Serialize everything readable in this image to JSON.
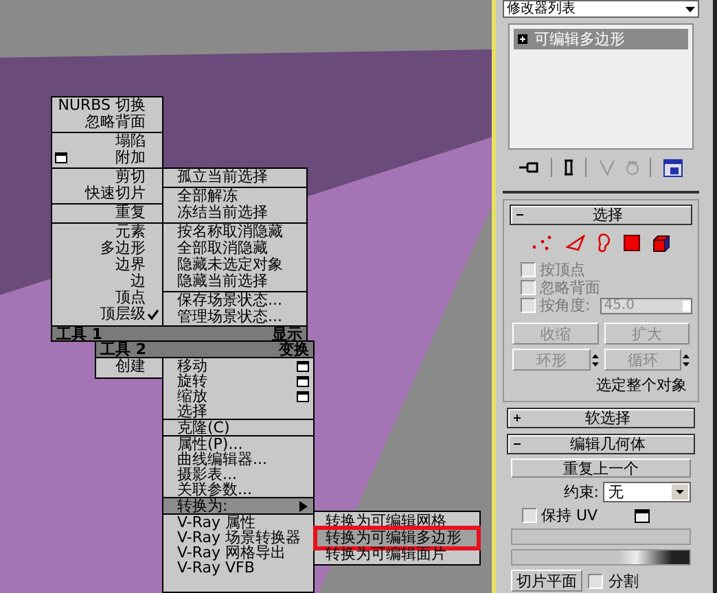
{
  "quad_menu": {
    "tools1": {
      "title": "工具 1",
      "groups": [
        [
          {
            "label": "NURBS 切换",
            "checked": false,
            "options": false
          },
          {
            "label": "忽略背面",
            "checked": false,
            "options": false
          }
        ],
        [
          {
            "label": "塌陷",
            "checked": false,
            "options": false
          },
          {
            "label": "附加",
            "checked": false,
            "options": true
          }
        ],
        [
          {
            "label": "剪切",
            "checked": false,
            "options": false
          },
          {
            "label": "快速切片",
            "checked": false,
            "options": false
          }
        ],
        [
          {
            "label": "重复",
            "checked": false,
            "options": false
          }
        ],
        [
          {
            "label": "元素",
            "checked": false,
            "options": false
          },
          {
            "label": "多边形",
            "checked": false,
            "options": false
          },
          {
            "label": "边界",
            "checked": false,
            "options": false
          },
          {
            "label": "边",
            "checked": false,
            "options": false
          },
          {
            "label": "顶点",
            "checked": false,
            "options": false
          },
          {
            "label": "顶层级",
            "checked": true,
            "options": false
          }
        ]
      ]
    },
    "display": {
      "title": "显示",
      "groups": [
        [
          {
            "label": "孤立当前选择",
            "checked": false,
            "options": false
          }
        ],
        [
          {
            "label": "全部解冻",
            "checked": false,
            "options": false
          },
          {
            "label": "冻结当前选择",
            "checked": false,
            "options": false
          }
        ],
        [
          {
            "label": "按名称取消隐藏",
            "checked": false,
            "options": false
          },
          {
            "label": "全部取消隐藏",
            "checked": false,
            "options": false
          },
          {
            "label": "隐藏未选定对象",
            "checked": false,
            "options": false
          },
          {
            "label": "隐藏当前选择",
            "checked": false,
            "options": false
          }
        ],
        [
          {
            "label": "保存场景状态...",
            "checked": false,
            "options": false
          },
          {
            "label": "管理场景状态...",
            "checked": false,
            "options": false
          }
        ]
      ]
    },
    "tools2": {
      "title": "工具 2",
      "groups": [
        [
          {
            "label": "创建",
            "checked": false,
            "options": false
          }
        ]
      ]
    },
    "transform": {
      "title": "变换",
      "groups": [
        [
          {
            "label": "移动",
            "checked": false,
            "options": true,
            "submenu": false,
            "selected": false
          },
          {
            "label": "旋转",
            "checked": false,
            "options": true,
            "submenu": false,
            "selected": false
          },
          {
            "label": "缩放",
            "checked": false,
            "options": true,
            "submenu": false,
            "selected": false
          },
          {
            "label": "选择",
            "checked": false,
            "options": false,
            "submenu": false,
            "selected": false
          }
        ],
        [
          {
            "label": "克隆(C)",
            "checked": false,
            "options": false,
            "submenu": false,
            "selected": false
          }
        ],
        [
          {
            "label": "属性(P)...",
            "checked": false,
            "options": false,
            "submenu": false,
            "selected": false
          },
          {
            "label": "曲线编辑器...",
            "checked": false,
            "options": false,
            "submenu": false,
            "selected": false
          },
          {
            "label": "摄影表...",
            "checked": false,
            "options": false,
            "submenu": false,
            "selected": false
          },
          {
            "label": "关联参数...",
            "checked": false,
            "options": false,
            "submenu": false,
            "selected": false
          }
        ],
        [
          {
            "label": "转换为:",
            "checked": false,
            "options": false,
            "submenu": true,
            "selected": true
          }
        ],
        [
          {
            "label": "V-Ray 属性",
            "checked": false,
            "options": false,
            "submenu": false,
            "selected": false
          },
          {
            "label": "V-Ray 场景转换器",
            "checked": false,
            "options": false,
            "submenu": false,
            "selected": false
          },
          {
            "label": "V-Ray 网格导出",
            "checked": false,
            "options": false,
            "submenu": false,
            "selected": false
          },
          {
            "label": "V-Ray VFB",
            "checked": false,
            "options": false,
            "submenu": false,
            "selected": false
          }
        ]
      ]
    },
    "convert_submenu": [
      {
        "label": "转换为可编辑网格",
        "selected": false,
        "callout": false
      },
      {
        "label": "转换为可编辑多边形",
        "selected": true,
        "callout": true
      },
      {
        "label": "转换为可编辑面片",
        "selected": false,
        "callout": false
      }
    ]
  },
  "command_panel": {
    "modifier_list": {
      "value": "修改器列表"
    },
    "stack": [
      {
        "label": "可编辑多边形",
        "selected": true
      }
    ],
    "selection": {
      "title": "选择",
      "expanded": true,
      "subobjects": [
        {
          "kind": "vertex",
          "selected": false
        },
        {
          "kind": "edge",
          "selected": false
        },
        {
          "kind": "border",
          "selected": false
        },
        {
          "kind": "polygon",
          "selected": false
        },
        {
          "kind": "element",
          "selected": false
        }
      ],
      "options": [
        {
          "label": "按顶点",
          "checked": false
        },
        {
          "label": "忽略背面",
          "checked": false
        },
        {
          "label": "按角度:",
          "checked": false,
          "value": "45.0"
        }
      ],
      "buttons": [
        {
          "label": "收缩",
          "kind": "button"
        },
        {
          "label": "扩大",
          "kind": "button"
        },
        {
          "label": "环形",
          "kind": "spinner"
        },
        {
          "label": "循环",
          "kind": "spinner"
        }
      ],
      "status": "选定整个对象"
    },
    "soft_selection": {
      "title": "软选择",
      "expanded": false
    },
    "edit_geometry": {
      "title": "编辑几何体",
      "expanded": true,
      "repeat_button": "重复上一个",
      "constraint": {
        "label": "约束:",
        "value": "无"
      },
      "preserve_uv": {
        "label": "保持 UV",
        "checked": false
      },
      "slice_plane": "切片平面",
      "split": {
        "label": "分割",
        "checked": false
      }
    }
  }
}
